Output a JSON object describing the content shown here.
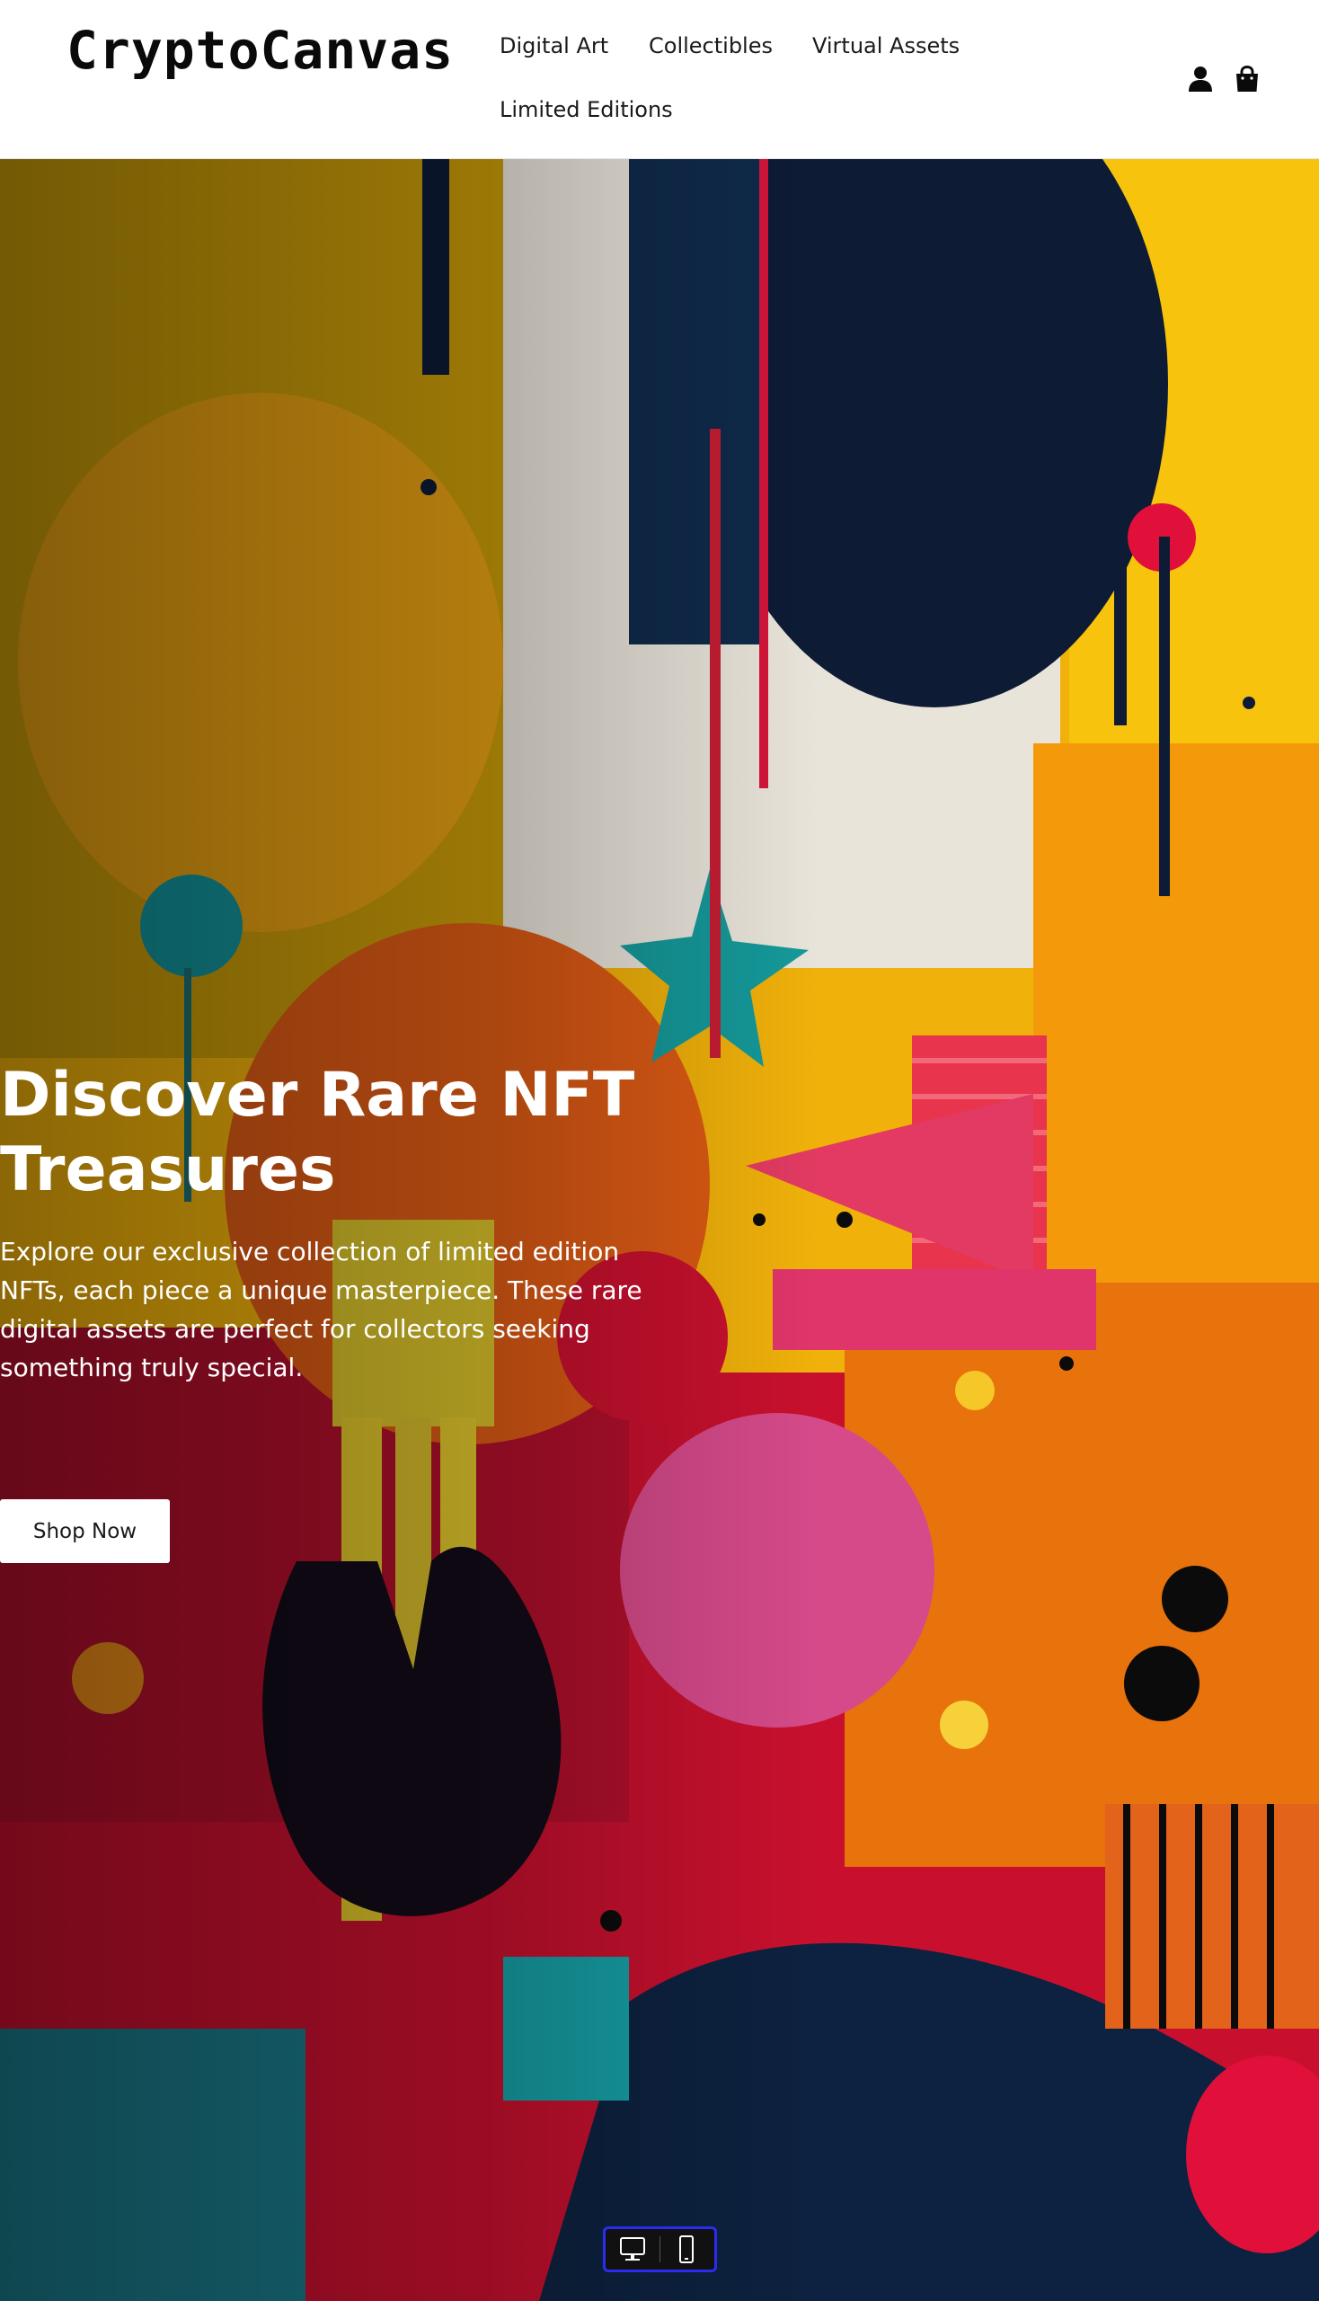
{
  "header": {
    "logo": "CryptoCanvas",
    "nav": [
      {
        "label": "Digital Art"
      },
      {
        "label": "Collectibles"
      },
      {
        "label": "Virtual Assets"
      },
      {
        "label": "Limited Editions"
      }
    ],
    "icons": [
      "account-icon",
      "cart-icon"
    ]
  },
  "hero": {
    "title": "Discover Rare NFT Treasures",
    "description": "Explore our exclusive collection of limited edition NFTs, each piece a unique masterpiece. These rare digital assets are perfect for collectors seeking something truly special.",
    "cta_label": "Shop Now"
  },
  "device_toggle": {
    "icons": [
      "desktop-icon",
      "mobile-icon"
    ]
  },
  "colors": {
    "accent_yellow": "#f2b705",
    "accent_red": "#d6112e",
    "accent_navy": "#0d1b35",
    "accent_teal": "#13939a",
    "toggle_border": "#2a2df0"
  }
}
